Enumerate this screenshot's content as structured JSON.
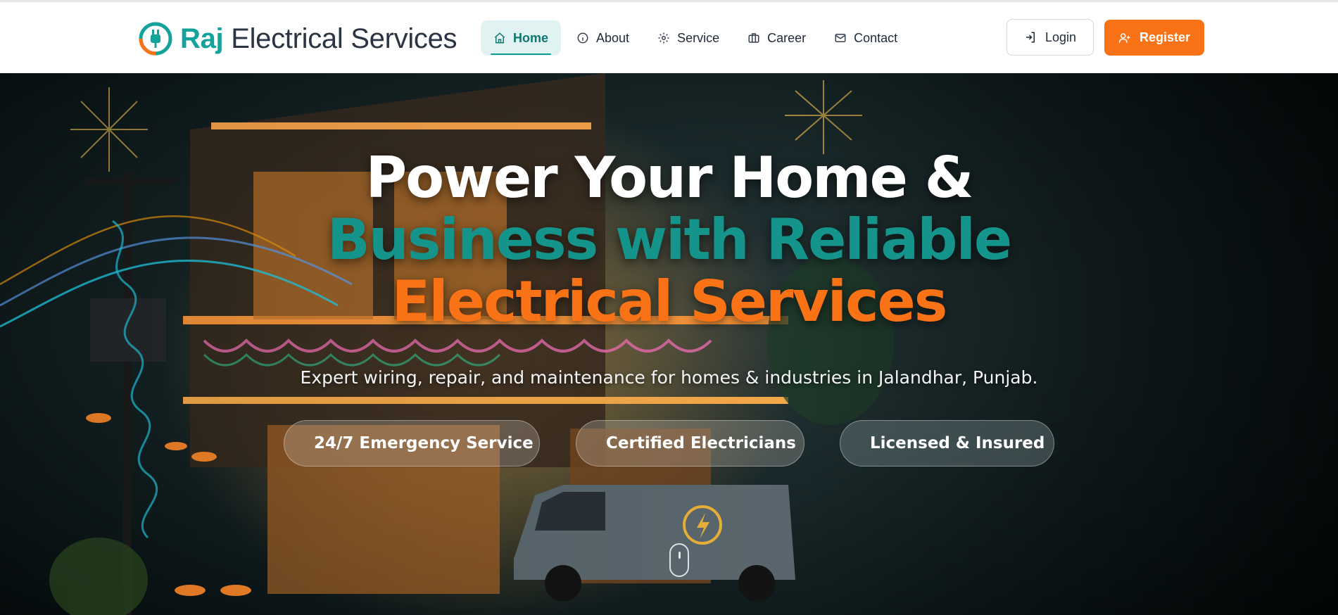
{
  "brand": {
    "name_highlight": "Raj",
    "name_rest": "Electrical Services",
    "logo_icon": "plug-icon",
    "colors": {
      "teal": "#14a39a",
      "orange": "#f97316",
      "dark": "#2b3442"
    }
  },
  "nav": {
    "items": [
      {
        "label": "Home",
        "icon": "home-icon",
        "active": true
      },
      {
        "label": "About",
        "icon": "info-icon",
        "active": false
      },
      {
        "label": "Service",
        "icon": "gear-icon",
        "active": false
      },
      {
        "label": "Career",
        "icon": "briefcase-icon",
        "active": false
      },
      {
        "label": "Contact",
        "icon": "mail-icon",
        "active": false
      }
    ]
  },
  "auth": {
    "login_label": "Login",
    "register_label": "Register"
  },
  "hero": {
    "headline_line1": "Power Your Home &",
    "headline_line2": "Business with Reliable",
    "headline_line3": "Electrical Services",
    "subtitle": "Expert wiring, repair, and maintenance for homes & industries in Jalandhar, Punjab.",
    "badges": [
      {
        "label": "24/7 Emergency Service",
        "icon": "clock-icon"
      },
      {
        "label": "Certified Electricians",
        "icon": "certificate-icon"
      },
      {
        "label": "Licensed & Insured",
        "icon": "shield-icon"
      }
    ]
  }
}
